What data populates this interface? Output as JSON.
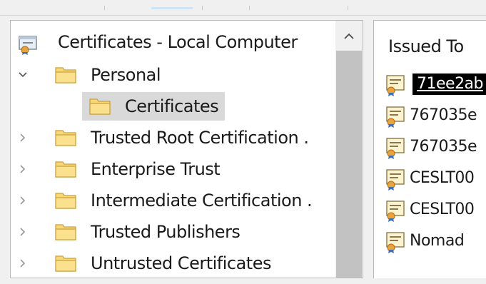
{
  "tree": {
    "root": {
      "label": "Certificates - Local Computer",
      "icon": "certificates-snapin-icon"
    },
    "items": [
      {
        "label": "Personal",
        "expanded": true,
        "icon": "folder-icon"
      },
      {
        "label": "Certificates",
        "selected": true,
        "icon": "folder-open-icon"
      },
      {
        "label": "Trusted Root Certification .",
        "expanded": false,
        "icon": "folder-icon"
      },
      {
        "label": "Enterprise Trust",
        "expanded": false,
        "icon": "folder-icon"
      },
      {
        "label": "Intermediate Certification .",
        "expanded": false,
        "icon": "folder-icon"
      },
      {
        "label": "Trusted Publishers",
        "expanded": false,
        "icon": "folder-icon"
      },
      {
        "label": "Untrusted Certificates",
        "expanded": false,
        "icon": "folder-icon"
      }
    ]
  },
  "list": {
    "column_header": "Issued To",
    "rows": [
      {
        "label": "71ee2ab",
        "redacted": true
      },
      {
        "label": "767035e"
      },
      {
        "label": "767035e"
      },
      {
        "label": "CESLT00"
      },
      {
        "label": "CESLT00"
      },
      {
        "label": "Nomad"
      }
    ]
  },
  "colors": {
    "selection": "#d9d9d9",
    "folder": "#f8d775",
    "scroll_thumb": "#c2c2c2"
  }
}
